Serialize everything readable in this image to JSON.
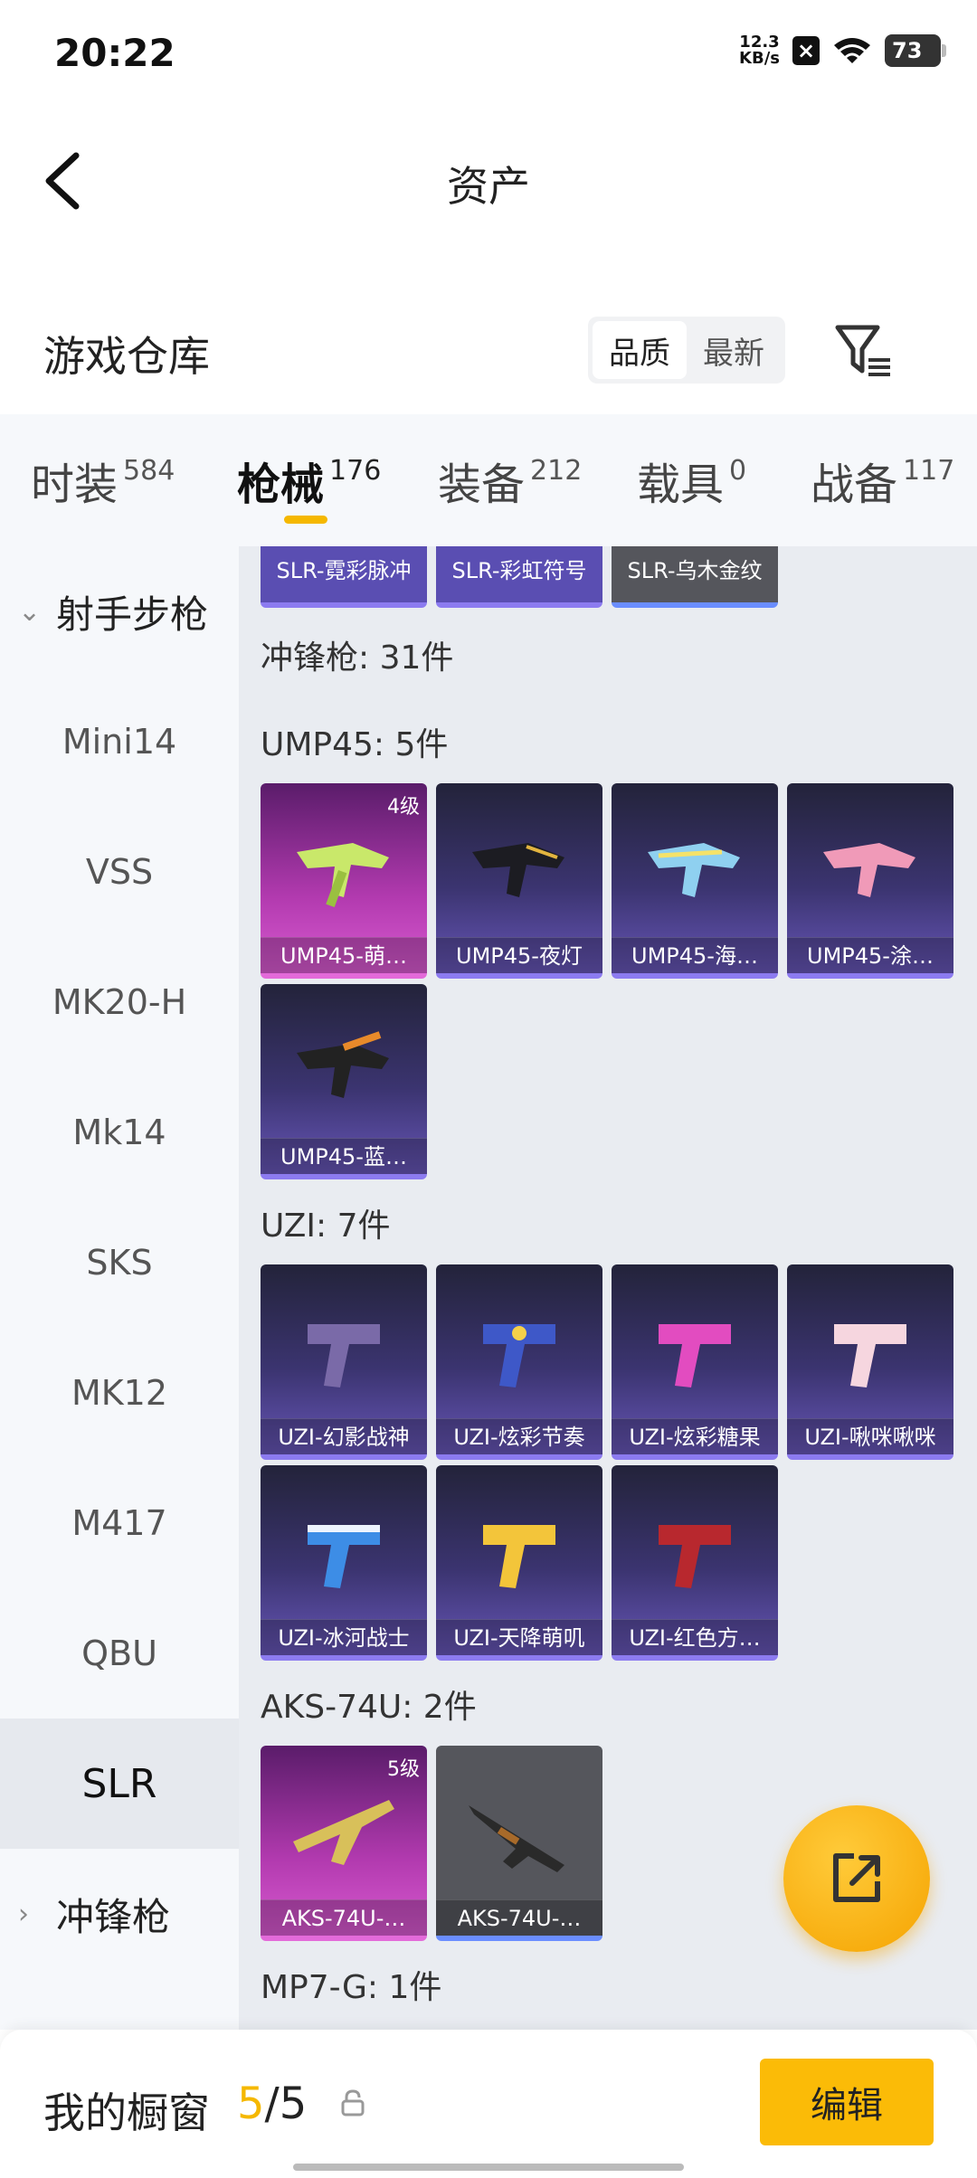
{
  "status": {
    "time": "20:22",
    "net_speed_value": "12.3",
    "net_speed_unit": "KB/s",
    "battery": "73"
  },
  "header": {
    "title": "资产"
  },
  "warehouse": {
    "title": "游戏仓库",
    "sort_options": [
      "品质",
      "最新"
    ],
    "selected_sort": "品质"
  },
  "tabs": [
    {
      "label": "时装",
      "count": "584"
    },
    {
      "label": "枪械",
      "count": "176"
    },
    {
      "label": "装备",
      "count": "212"
    },
    {
      "label": "载具",
      "count": "0"
    },
    {
      "label": "战备",
      "count": "117"
    }
  ],
  "active_tab": "枪械",
  "sidebar": {
    "group_open": "射手步枪",
    "items": [
      "Mini14",
      "VSS",
      "MK20-H",
      "Mk14",
      "SKS",
      "MK12",
      "M417",
      "QBU",
      "SLR"
    ],
    "selected": "SLR",
    "group_next": "冲锋枪"
  },
  "content": {
    "slr_partial": [
      "SLR-霓彩脉冲",
      "SLR-彩虹符号",
      "SLR-乌木金纹"
    ],
    "smg_header": "冲锋枪: 31件",
    "ump_header": "UMP45: 5件",
    "ump": [
      {
        "name": "UMP45-萌…",
        "level": "4级"
      },
      {
        "name": "UMP45-夜灯"
      },
      {
        "name": "UMP45-海…"
      },
      {
        "name": "UMP45-涂…"
      },
      {
        "name": "UMP45-蓝…"
      }
    ],
    "uzi_header": "UZI: 7件",
    "uzi": [
      "UZI-幻影战神",
      "UZI-炫彩节奏",
      "UZI-炫彩糖果",
      "UZI-啾咪啾咪",
      "UZI-冰河战士",
      "UZI-天降萌叽",
      "UZI-红色方…"
    ],
    "aks_header": "AKS-74U: 2件",
    "aks": [
      {
        "name": "AKS-74U-…",
        "level": "5级"
      },
      {
        "name": "AKS-74U-…"
      }
    ],
    "mp7_header": "MP7-G: 1件"
  },
  "bottom": {
    "showcase_label": "我的橱窗",
    "showcase_current": "5",
    "showcase_sep": "/",
    "showcase_total": "5",
    "edit_label": "编辑"
  },
  "colors": {
    "accent": "#f5b800",
    "card_purple": "#3b3470",
    "card_pink": "#b23aaf",
    "card_gray": "#55565c"
  }
}
